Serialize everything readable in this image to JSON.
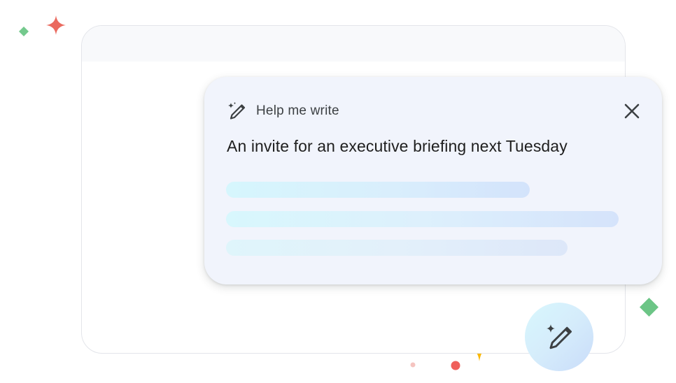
{
  "help_me_write": {
    "title": "Help me write",
    "prompt": "An invite for an executive briefing next Tuesday"
  },
  "icons": {
    "header_icon": "magic-wand-pencil-icon",
    "close_icon": "close-icon",
    "fab_icon": "magic-wand-pencil-icon"
  },
  "colors": {
    "card_background": "#f1f4fc",
    "sparkle_red": "#ea6a5f",
    "sparkle_green": "#6cc586",
    "sparkle_yellow": "#fbb803",
    "dot_red": "#ef5f5a"
  }
}
